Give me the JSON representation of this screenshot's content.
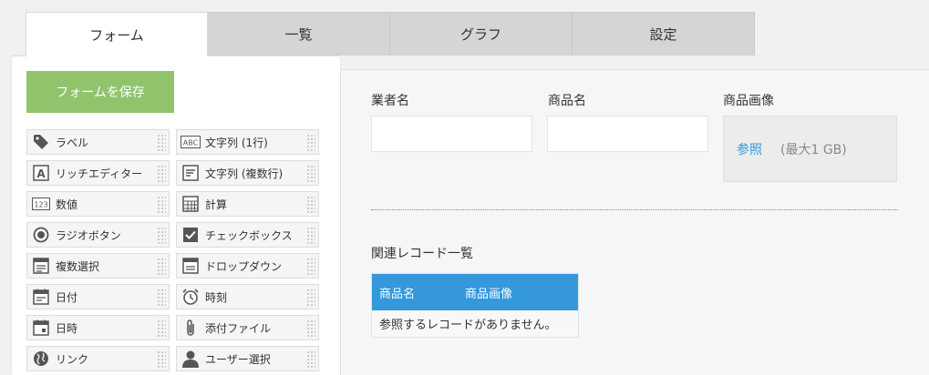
{
  "tabs": [
    {
      "label": "フォーム",
      "active": true
    },
    {
      "label": "一覧",
      "active": false
    },
    {
      "label": "グラフ",
      "active": false
    },
    {
      "label": "設定",
      "active": false
    }
  ],
  "palette": {
    "save_label": "フォームを保存",
    "items": [
      {
        "label": "ラベル",
        "icon": "tag-icon"
      },
      {
        "label": "文字列 (1行)",
        "icon": "abc-text-icon"
      },
      {
        "label": "リッチエディター",
        "icon": "rich-editor-icon"
      },
      {
        "label": "文字列 (複数行)",
        "icon": "multiline-text-icon"
      },
      {
        "label": "数値",
        "icon": "number-123-icon"
      },
      {
        "label": "計算",
        "icon": "calculator-icon"
      },
      {
        "label": "ラジオボタン",
        "icon": "radio-button-icon"
      },
      {
        "label": "チェックボックス",
        "icon": "checkbox-icon"
      },
      {
        "label": "複数選択",
        "icon": "multi-select-icon"
      },
      {
        "label": "ドロップダウン",
        "icon": "dropdown-icon"
      },
      {
        "label": "日付",
        "icon": "calendar-icon"
      },
      {
        "label": "時刻",
        "icon": "alarm-clock-icon"
      },
      {
        "label": "日時",
        "icon": "datetime-icon"
      },
      {
        "label": "添付ファイル",
        "icon": "paperclip-icon"
      },
      {
        "label": "リンク",
        "icon": "globe-icon"
      },
      {
        "label": "ユーザー選択",
        "icon": "user-icon"
      }
    ]
  },
  "form": {
    "vendor_label": "業者名",
    "product_label": "商品名",
    "image_label": "商品画像",
    "browse_label": "参照",
    "size_limit": "(最大1 GB)",
    "related_title": "関連レコード一覧",
    "related_columns": [
      "商品名",
      "商品画像"
    ],
    "related_empty": "参照するレコードがありません。"
  },
  "colors": {
    "save_button": "#8fc46d",
    "table_header": "#3498db",
    "link": "#3498db"
  }
}
